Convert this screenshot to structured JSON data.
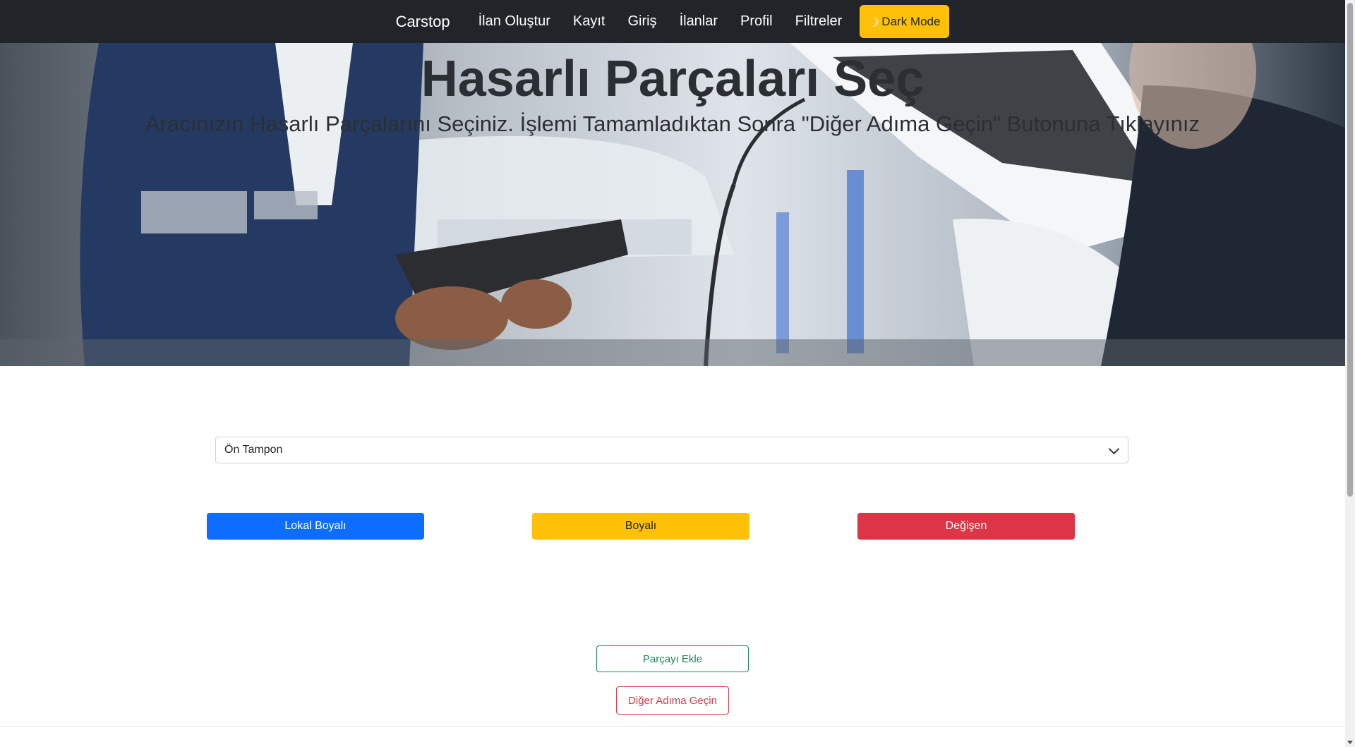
{
  "navbar": {
    "brand": "Carstop",
    "links": [
      "İlan Oluştur",
      "Kayıt",
      "Giriş",
      "İlanlar",
      "Profil",
      "Filtreler"
    ],
    "dark_mode_label": "Dark Mode",
    "dark_mode_icon": "moon-icon"
  },
  "hero": {
    "title": "Hasarlı Parçaları Seç",
    "subtitle": "Aracınızın Hasarlı Parçalarını Seçiniz. İşlemi Tamamladıktan Sonra \"Diğer Adıma Geçin\" Butonuna Tıklayınız"
  },
  "form": {
    "part_select_value": "Ön Tampon",
    "options": [
      "Lokal Boyalı",
      "Boyalı",
      "Değişen"
    ],
    "add_part_label": "Parçayı Ekle",
    "next_step_label": "Diğer Adıma Geçin"
  },
  "colors": {
    "navbar_bg": "#212529",
    "primary": "#0d6efd",
    "warning": "#ffc107",
    "danger": "#dc3545",
    "success": "#198754"
  }
}
